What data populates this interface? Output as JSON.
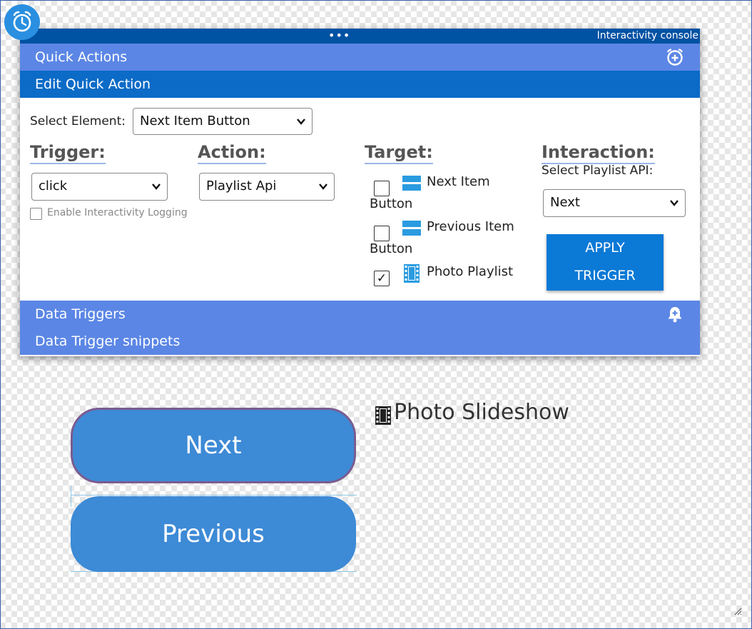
{
  "console": {
    "title": "Interactivity console",
    "dots": "•••",
    "quick_actions_label": "Quick Actions",
    "edit_quick_action_label": "Edit Quick Action",
    "data_triggers_label": "Data Triggers",
    "data_trigger_snippets_label": "Data Trigger snippets"
  },
  "edit": {
    "select_element_label": "Select Element:",
    "select_element_value": "Next Item Button",
    "trigger_heading": "Trigger:",
    "trigger_value": "click",
    "logging_label": "Enable Interactivity Logging",
    "logging_checked": false,
    "action_heading": "Action:",
    "action_value": "Playlist Api",
    "target_heading": "Target:",
    "targets": [
      {
        "line1": "Next Item",
        "line2": "Button",
        "checked": false,
        "icon": "button-icon",
        "mark": ""
      },
      {
        "line1": "Previous Item",
        "line2": "Button",
        "checked": false,
        "icon": "button-icon",
        "mark": ""
      },
      {
        "line1": "Photo Playlist",
        "line2": "",
        "checked": true,
        "icon": "film-icon",
        "mark": "✓"
      }
    ],
    "interaction_heading": "Interaction:",
    "playlist_api_label": "Select Playlist API:",
    "playlist_api_value": "Next",
    "apply_line1": "APPLY",
    "apply_line2": "TRIGGER"
  },
  "stage": {
    "next_button_label": "Next",
    "previous_button_label": "Previous",
    "slideshow_title": "Photo Slideshow"
  },
  "colors": {
    "titlebar": "#0052a3",
    "bar_light": "#5b86e5",
    "bar_dark": "#0b6bc7",
    "pill_blue": "#3d8ad6",
    "alarm_badge": "#2a8fe0"
  }
}
